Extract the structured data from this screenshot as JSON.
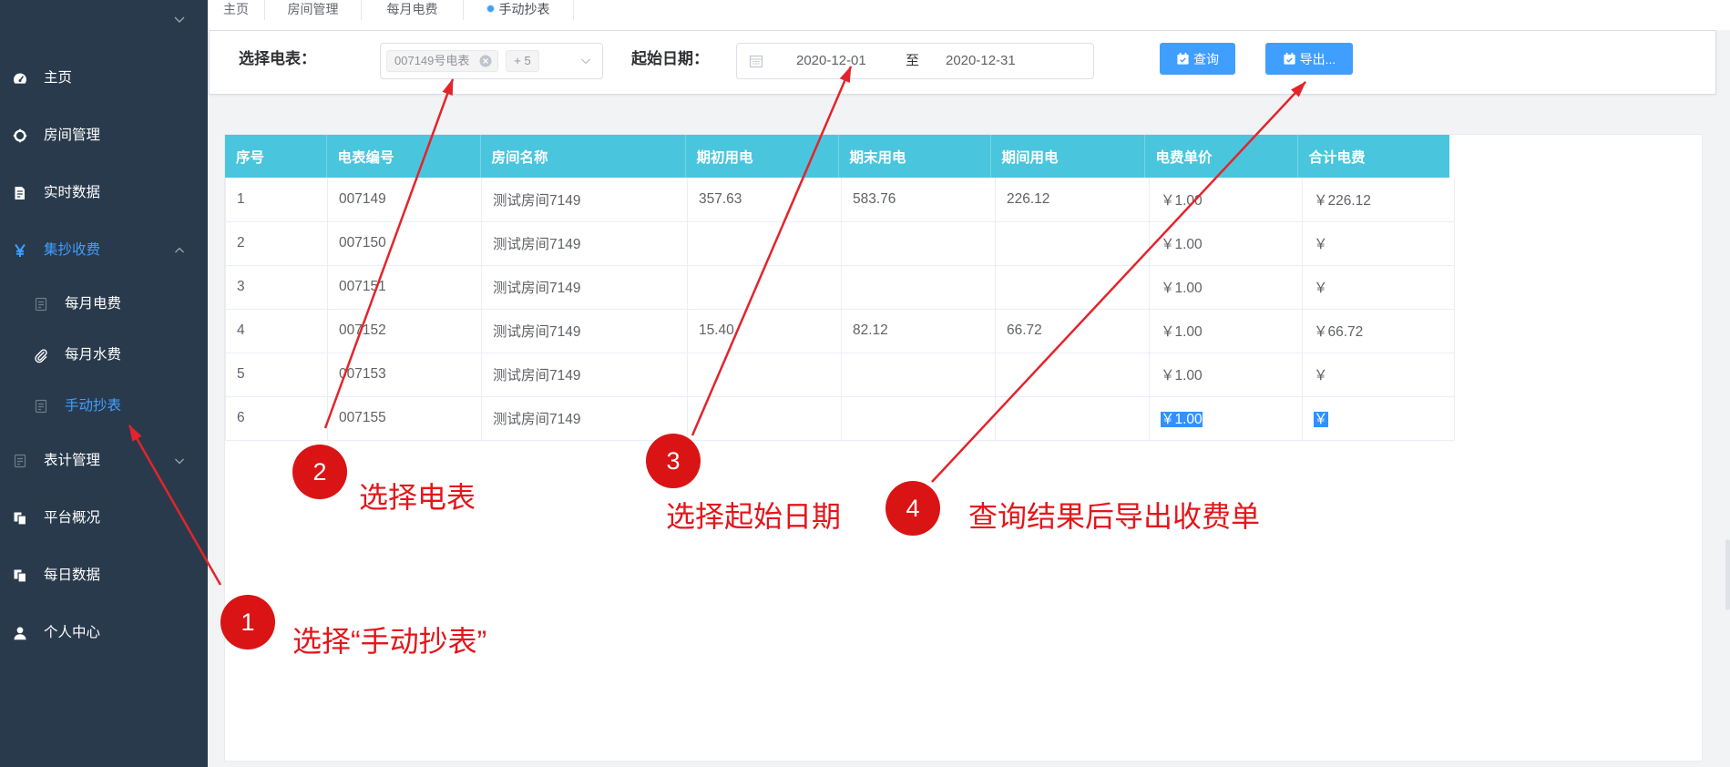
{
  "theme": {
    "sidebar_bg": "#293a4c",
    "accent": "#409eff",
    "table_header_bg": "#4ac5de",
    "annotation_red": "#e3161b"
  },
  "sidebar": {
    "toggle_icon": "chevron-down-icon",
    "items": [
      {
        "label": "主页",
        "icon": "dashboard-icon"
      },
      {
        "label": "房间管理",
        "icon": "aim-icon"
      },
      {
        "label": "实时数据",
        "icon": "document-icon"
      },
      {
        "label": "集抄收费",
        "icon": "yen-icon",
        "active": true,
        "expanded": true,
        "arrow_icon": "chevron-up-icon",
        "children": [
          {
            "label": "每月电费",
            "icon": "document-outline-icon"
          },
          {
            "label": "每月水费",
            "icon": "paperclip-icon"
          },
          {
            "label": "手动抄表",
            "icon": "document-outline-icon",
            "active": true
          }
        ]
      },
      {
        "label": "表计管理",
        "icon": "document-outline-icon",
        "arrow_icon": "chevron-down-icon"
      },
      {
        "label": "平台概况",
        "icon": "copy-icon"
      },
      {
        "label": "每日数据",
        "icon": "copy-icon"
      },
      {
        "label": "个人中心",
        "icon": "user-icon"
      }
    ]
  },
  "tabs": [
    {
      "label": "主页"
    },
    {
      "label": "房间管理"
    },
    {
      "label": "每月电费"
    },
    {
      "label": "手动抄表",
      "active": true
    }
  ],
  "query": {
    "meter_label": "选择电表：",
    "meter_tags": [
      "007149号电表",
      "+ 5"
    ],
    "date_label": "起始日期：",
    "start_date": "2020-12-01",
    "range_separator": "至",
    "end_date": "2020-12-31",
    "search_button": "查询",
    "export_button": "导出..."
  },
  "table": {
    "columns": [
      "序号",
      "电表编号",
      "房间名称",
      "期初用电",
      "期末用电",
      "期间用电",
      "电费单价",
      "合计电费"
    ],
    "rows": [
      [
        "1",
        "007149",
        "测试房间7149",
        "357.63",
        "583.76",
        "226.12",
        "￥1.00",
        "￥226.12"
      ],
      [
        "2",
        "007150",
        "测试房间7149",
        "",
        "",
        "",
        "￥1.00",
        "￥"
      ],
      [
        "3",
        "007151",
        "测试房间7149",
        "",
        "",
        "",
        "￥1.00",
        "￥"
      ],
      [
        "4",
        "007152",
        "测试房间7149",
        "15.40",
        "82.12",
        "66.72",
        "￥1.00",
        "￥66.72"
      ],
      [
        "5",
        "007153",
        "测试房间7149",
        "",
        "",
        "",
        "￥1.00",
        "￥"
      ],
      [
        "6",
        "007155",
        "测试房间7149",
        "",
        "",
        "",
        "￥1.00",
        "￥"
      ]
    ]
  },
  "annotations": [
    {
      "number": "1",
      "text": "选择“手动抄表”"
    },
    {
      "number": "2",
      "text": "选择电表"
    },
    {
      "number": "3",
      "text": "选择起始日期"
    },
    {
      "number": "4",
      "text": "查询结果后导出收费单"
    }
  ]
}
